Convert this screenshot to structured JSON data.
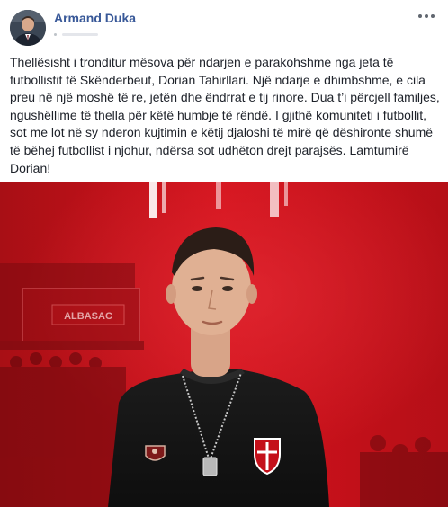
{
  "post": {
    "author": "Armand Duka",
    "text": "Thellësisht i tronditur mësova për ndarjen e parakohshme nga jeta të futbollistit të Skënderbeut, Dorian Tahirllari. Një ndarje e dhimbshme, e cila preu në një moshë të re, jetën dhe ëndrrat e tij rinore. Dua t’i përcjell familjes, ngushëllime të thella për këtë humbje të rëndë. I gjithë komuniteti i futbollit, sot me lot në sy nderon kujtimin e këtij djaloshi të mirë që dëshironte shumë të bëhej futbollist i njohur, ndërsa sot udhëton drejt parajsës. Lamtumirë Dorian!"
  },
  "image": {
    "banner_text": "ALBASAC",
    "colors": {
      "background": "#c4101a",
      "shirt": "#151515",
      "link": "#385898"
    }
  }
}
